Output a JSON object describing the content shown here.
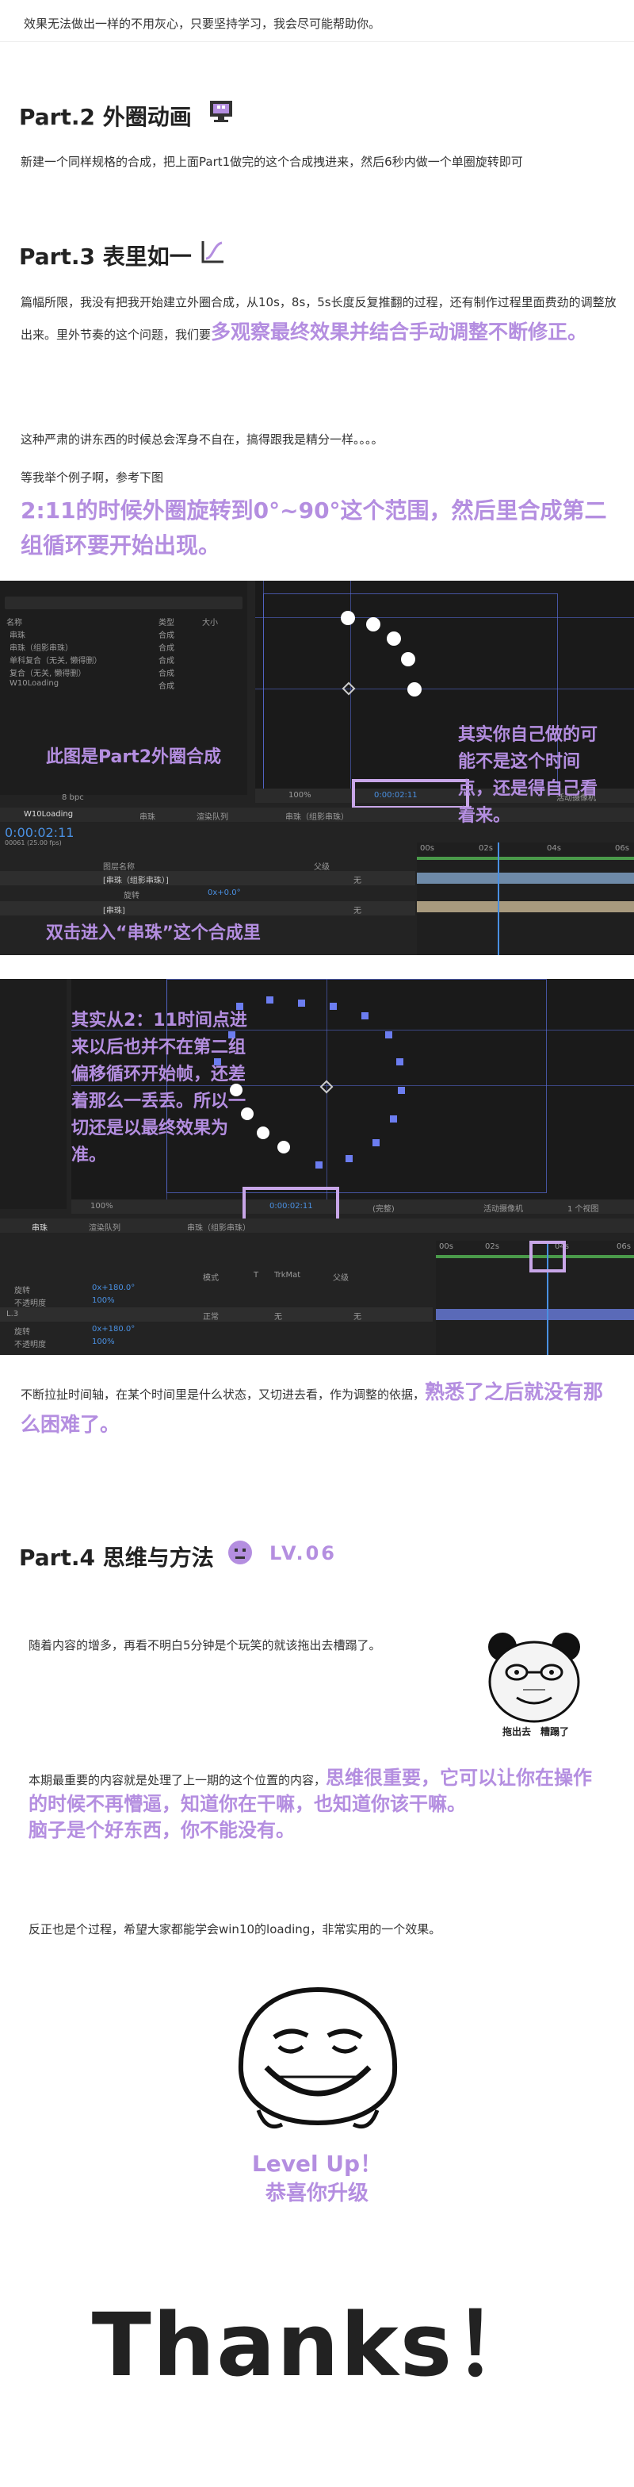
{
  "intro": "效果无法做出一样的不用灰心，只要坚持学习，我会尽可能帮助你。",
  "part2": {
    "title": "Part.2 外圈动画",
    "icon": "pixel-monitor-icon",
    "text": "新建一个同样规格的合成，把上面Part1做完的这个合成拽进来，然后6秒内做一个单圈旋转即可"
  },
  "part3": {
    "title": "Part.3 表里如一",
    "icon": "curve-graph-icon",
    "text_a": "篇幅所限，我没有把我开始建立外圈合成，从10s，8s，5s长度反复推翻的过程，还有制作过程里面费劲的调整放出来。里外节奏的这个问题，我们要",
    "text_a_hl": "多观察最终效果并结合手动调整不断修正。",
    "text_b": "这种严肃的讲东西的时候总会浑身不自在，搞得跟我是精分一样。。。。",
    "text_c": "等我举个例子啊，参考下图",
    "text_d": "2:11的时候外圈旋转到0°~90°这个范围，然后里合成第二组循环要开始出现。"
  },
  "shot1": {
    "project_items": [
      "串珠",
      "串珠（组影串珠）",
      "单科复合（无关, 懒得删）",
      "复合（无关, 懒得删）",
      "W10Loading"
    ],
    "project_types": [
      "合成",
      "合成",
      "合成",
      "合成",
      "合成"
    ],
    "col_name": "名称",
    "col_type": "类型",
    "col_size": "大小",
    "bpc": "8 bpc",
    "zoom": "100%",
    "time_code": "0:00:02:11",
    "camera": "活动摄像机",
    "tab1": "W10Loading",
    "tab2": "串珠",
    "tab3": "渲染队列",
    "tab4": "串珠（组影串珠）",
    "tl_time": "0:00:02:11",
    "tl_fps": "00061 (25.00 fps)",
    "layer_header": "图层名称",
    "parent_header": "父级",
    "layer1": "[串珠（组影串珠）]",
    "layer1_sub": "旋转",
    "layer1_val": "0x+0.0°",
    "layer2": "[串珠]",
    "none1": "无",
    "none2": "无",
    "ruler": [
      "00s",
      "02s",
      "04s",
      "06s"
    ],
    "note_left": "此图是Part2外圈合成",
    "note_right": "其实你自己做的可能不是这个时间点，还是得自己看着来。",
    "note_bottom": "双击进入“串珠”这个合成里"
  },
  "shot2": {
    "time_code": "0:00:02:11",
    "zoom": "100%",
    "quality": "(完整)",
    "camera": "活动摄像机",
    "views": "1 个视图",
    "tab1": "串珠",
    "tab2": "渲染队列",
    "tab3": "串珠（组影串珠）",
    "rows": [
      {
        "label": "旋转",
        "val": "0x+180.0°"
      },
      {
        "label": "不透明度",
        "val": "100%"
      },
      {
        "label": "L.3",
        "val": "正常"
      },
      {
        "label": "旋转",
        "val": "0x+180.0°"
      },
      {
        "label": "不透明度",
        "val": "100%"
      }
    ],
    "col_mode": "模式",
    "col_t": "T",
    "col_trk": "TrkMat",
    "col_parent": "父级",
    "none1": "无",
    "none2": "无",
    "none3": "无",
    "ruler": [
      "00s",
      "02s",
      "04s",
      "06s"
    ],
    "note": "其实从2：11时间点进来以后也并不在第二组偏移循环开始帧，还差着那么一丢丢。所以一切还是以最终效果为准。"
  },
  "after": {
    "text": "不断拉扯时间轴，在某个时间里是什么状态，又切进去看，作为调整的依据，",
    "text_hl": "熟悉了之后就没有那么困难了。"
  },
  "part4": {
    "title": "Part.4 思维与方法",
    "icon": "purple-face-icon",
    "level": "LV.06",
    "text_a": "随着内容的增多，再看不明白5分钟是个玩笑的就该拖出去槽蹋了。",
    "meme_caption": "拖出去　糟蹋了",
    "text_b": "本期最重要的内容就是处理了上一期的这个位置的内容，",
    "text_b_hl": "思维很重要，它可以让你在操作的时候不再懵逼，知道你在干嘛，也知道你该干嘛。",
    "text_b_hl2": "脑子是个好东西，你不能没有。",
    "text_c": "反正也是个过程，希望大家都能学会win10的loading，非常实用的一个效果。",
    "levelup": "Level Up！",
    "levelup2": "恭喜你升级"
  },
  "thanks": "Thanks！",
  "colors": {
    "accent": "#b48ee0",
    "ae_bg": "#232323",
    "ae_blue": "#4a90e2",
    "grid": "#5a6edc"
  }
}
